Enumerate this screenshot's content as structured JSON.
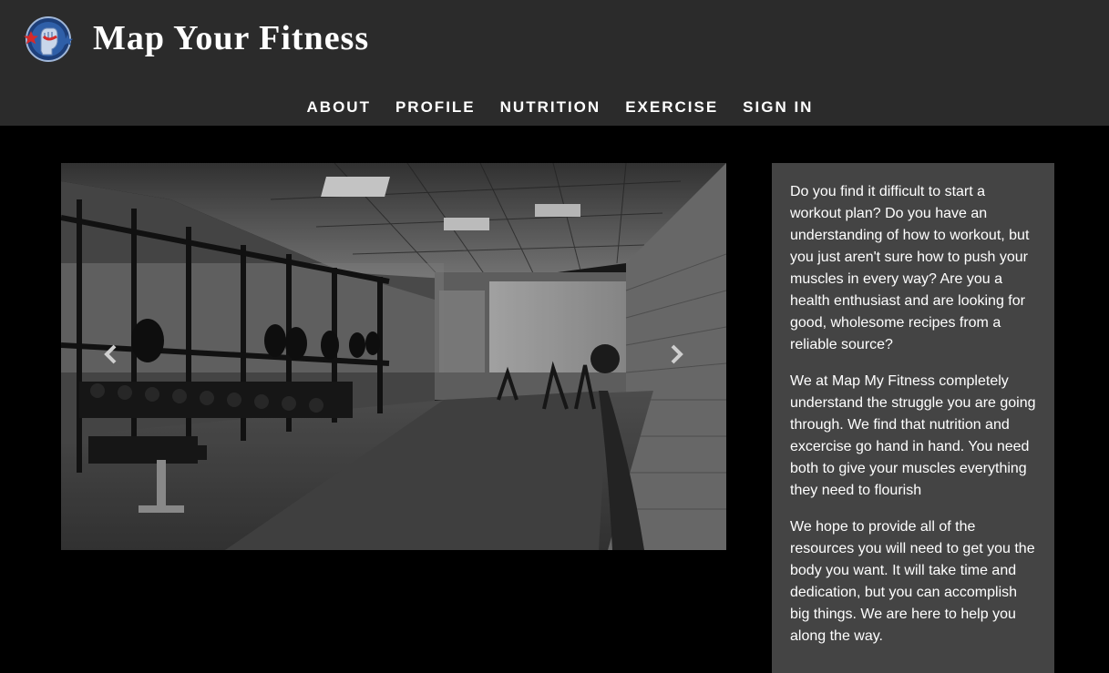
{
  "header": {
    "title": "Map Your Fitness",
    "logo_icon": "raised-fist-star-logo-icon"
  },
  "nav": {
    "items": [
      {
        "label": "ABOUT"
      },
      {
        "label": "PROFILE"
      },
      {
        "label": "NUTRITION"
      },
      {
        "label": "EXERCISE"
      },
      {
        "label": "SIGN IN"
      }
    ]
  },
  "carousel": {
    "image_subject": "gym interior photo (grayscale)",
    "prev_icon": "chevron-left-icon",
    "next_icon": "chevron-right-icon"
  },
  "intro": {
    "paragraphs": [
      "Do you find it difficult to start a workout plan? Do you have an understanding of how to workout, but you just aren't sure how to push your muscles in every way? Are you a health enthusiast and are looking for good, wholesome recipes from a reliable source?",
      "We at Map My Fitness completely understand the struggle you are going through. We find that nutrition and excercise go hand in hand. You need both to give your muscles everything they need to flourish",
      "We hope to provide all of the resources you will need to get you the body you want. It will take time and dedication, but you can accomplish big things. We are here to help you along the way."
    ]
  },
  "colors": {
    "header_bg": "#2b2b2b",
    "page_bg": "#000000",
    "panel_bg": "#444444",
    "logo_blue": "#2f5fa8",
    "logo_red": "#d62a2a"
  }
}
